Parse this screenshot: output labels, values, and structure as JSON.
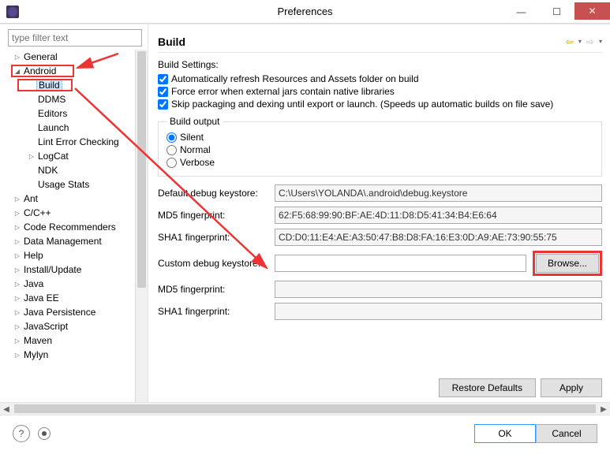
{
  "window": {
    "title": "Preferences"
  },
  "filter_placeholder": "type filter text",
  "tree": [
    {
      "label": "General",
      "depth": 0,
      "arrow": "collapsed"
    },
    {
      "label": "Android",
      "depth": 0,
      "arrow": "expanded",
      "boxed": true
    },
    {
      "label": "Build",
      "depth": 1,
      "arrow": "none",
      "selected": true,
      "boxed": true
    },
    {
      "label": "DDMS",
      "depth": 1,
      "arrow": "none"
    },
    {
      "label": "Editors",
      "depth": 1,
      "arrow": "none"
    },
    {
      "label": "Launch",
      "depth": 1,
      "arrow": "none"
    },
    {
      "label": "Lint Error Checking",
      "depth": 1,
      "arrow": "none"
    },
    {
      "label": "LogCat",
      "depth": 1,
      "arrow": "collapsed"
    },
    {
      "label": "NDK",
      "depth": 1,
      "arrow": "none"
    },
    {
      "label": "Usage Stats",
      "depth": 1,
      "arrow": "none"
    },
    {
      "label": "Ant",
      "depth": 0,
      "arrow": "collapsed"
    },
    {
      "label": "C/C++",
      "depth": 0,
      "arrow": "collapsed"
    },
    {
      "label": "Code Recommenders",
      "depth": 0,
      "arrow": "collapsed"
    },
    {
      "label": "Data Management",
      "depth": 0,
      "arrow": "collapsed"
    },
    {
      "label": "Help",
      "depth": 0,
      "arrow": "collapsed"
    },
    {
      "label": "Install/Update",
      "depth": 0,
      "arrow": "collapsed"
    },
    {
      "label": "Java",
      "depth": 0,
      "arrow": "collapsed"
    },
    {
      "label": "Java EE",
      "depth": 0,
      "arrow": "collapsed"
    },
    {
      "label": "Java Persistence",
      "depth": 0,
      "arrow": "collapsed"
    },
    {
      "label": "JavaScript",
      "depth": 0,
      "arrow": "collapsed"
    },
    {
      "label": "Maven",
      "depth": 0,
      "arrow": "collapsed"
    },
    {
      "label": "Mylyn",
      "depth": 0,
      "arrow": "collapsed"
    }
  ],
  "page": {
    "heading": "Build",
    "settings_label": "Build Settings:",
    "checks": [
      "Automatically refresh Resources and Assets folder on build",
      "Force error when external jars contain native libraries",
      "Skip packaging and dexing until export or launch. (Speeds up automatic builds on file save)"
    ],
    "build_output_legend": "Build output",
    "radios": [
      "Silent",
      "Normal",
      "Verbose"
    ],
    "radio_selected": 0,
    "fields": {
      "default_keystore_label": "Default debug keystore:",
      "default_keystore_value": "C:\\Users\\YOLANDA\\.android\\debug.keystore",
      "md5_label": "MD5 fingerprint:",
      "md5_value": "62:F5:68:99:90:BF:AE:4D:11:D8:D5:41:34:B4:E6:64",
      "sha1_label": "SHA1 fingerprint:",
      "sha1_value": "CD:D0:11:E4:AE:A3:50:47:B8:D8:FA:16:E3:0D:A9:AE:73:90:55:75",
      "custom_keystore_label": "Custom debug keystore:",
      "custom_keystore_value": "",
      "browse_label": "Browse...",
      "md5_2_label": "MD5 fingerprint:",
      "md5_2_value": "",
      "sha1_2_label": "SHA1 fingerprint:",
      "sha1_2_value": ""
    },
    "restore_label": "Restore Defaults",
    "apply_label": "Apply"
  },
  "footer": {
    "ok": "OK",
    "cancel": "Cancel"
  }
}
